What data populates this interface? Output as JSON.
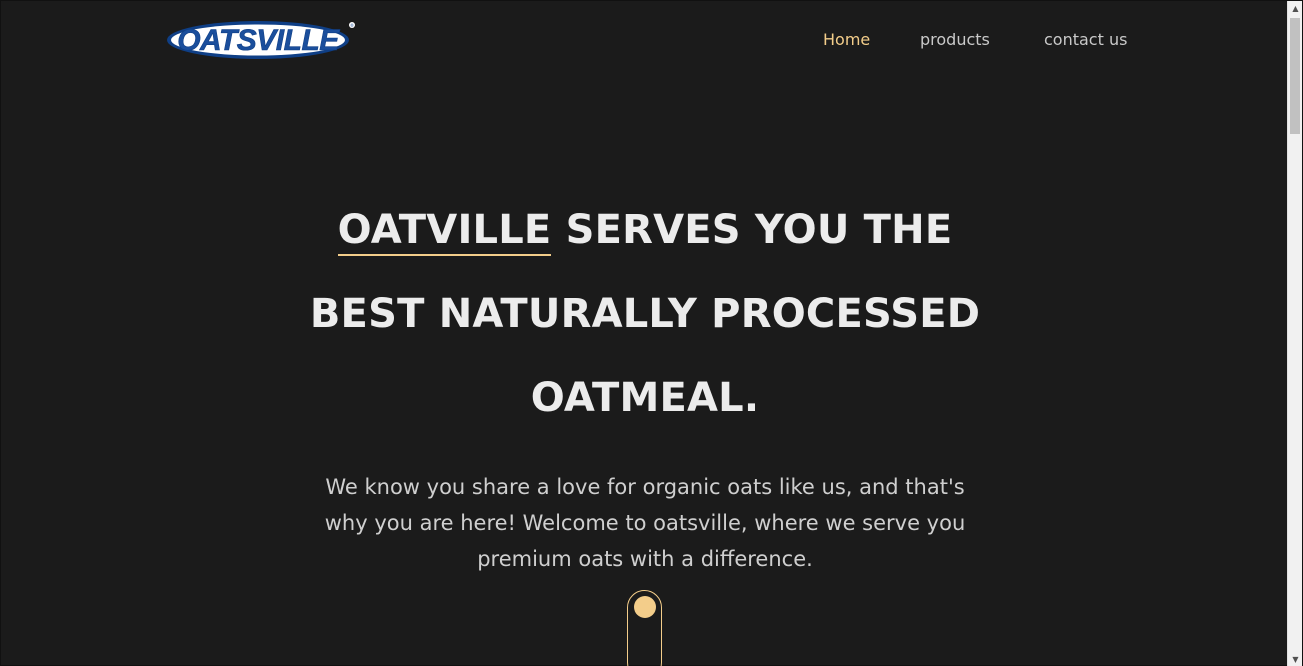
{
  "header": {
    "logo_text": "OATSVILLE",
    "nav": [
      {
        "label": "Home",
        "active": true
      },
      {
        "label": "products",
        "active": false
      },
      {
        "label": "contact us",
        "active": false
      }
    ]
  },
  "hero": {
    "title_highlight": "OATVILLE",
    "title_line1_rest": " SERVES YOU THE",
    "title_line2": "BEST NATURALLY PROCESSED",
    "title_line3": "OATMEAL.",
    "subtitle": "We know you share a love for organic oats like us, and that's why you are here! Welcome to oatsville, where we serve you premium oats with a difference."
  },
  "colors": {
    "background": "#1b1b1b",
    "accent": "#f3cd8a",
    "heading": "#ececec",
    "body_text": "#cfcfcf",
    "nav_text": "#c9c9c9",
    "logo_blue": "#1a4e9c"
  },
  "icons": {
    "scroll_indicator": "mouse-scroll-icon",
    "scroll_up": "arrow-up-icon",
    "scroll_down": "arrow-down-icon"
  }
}
